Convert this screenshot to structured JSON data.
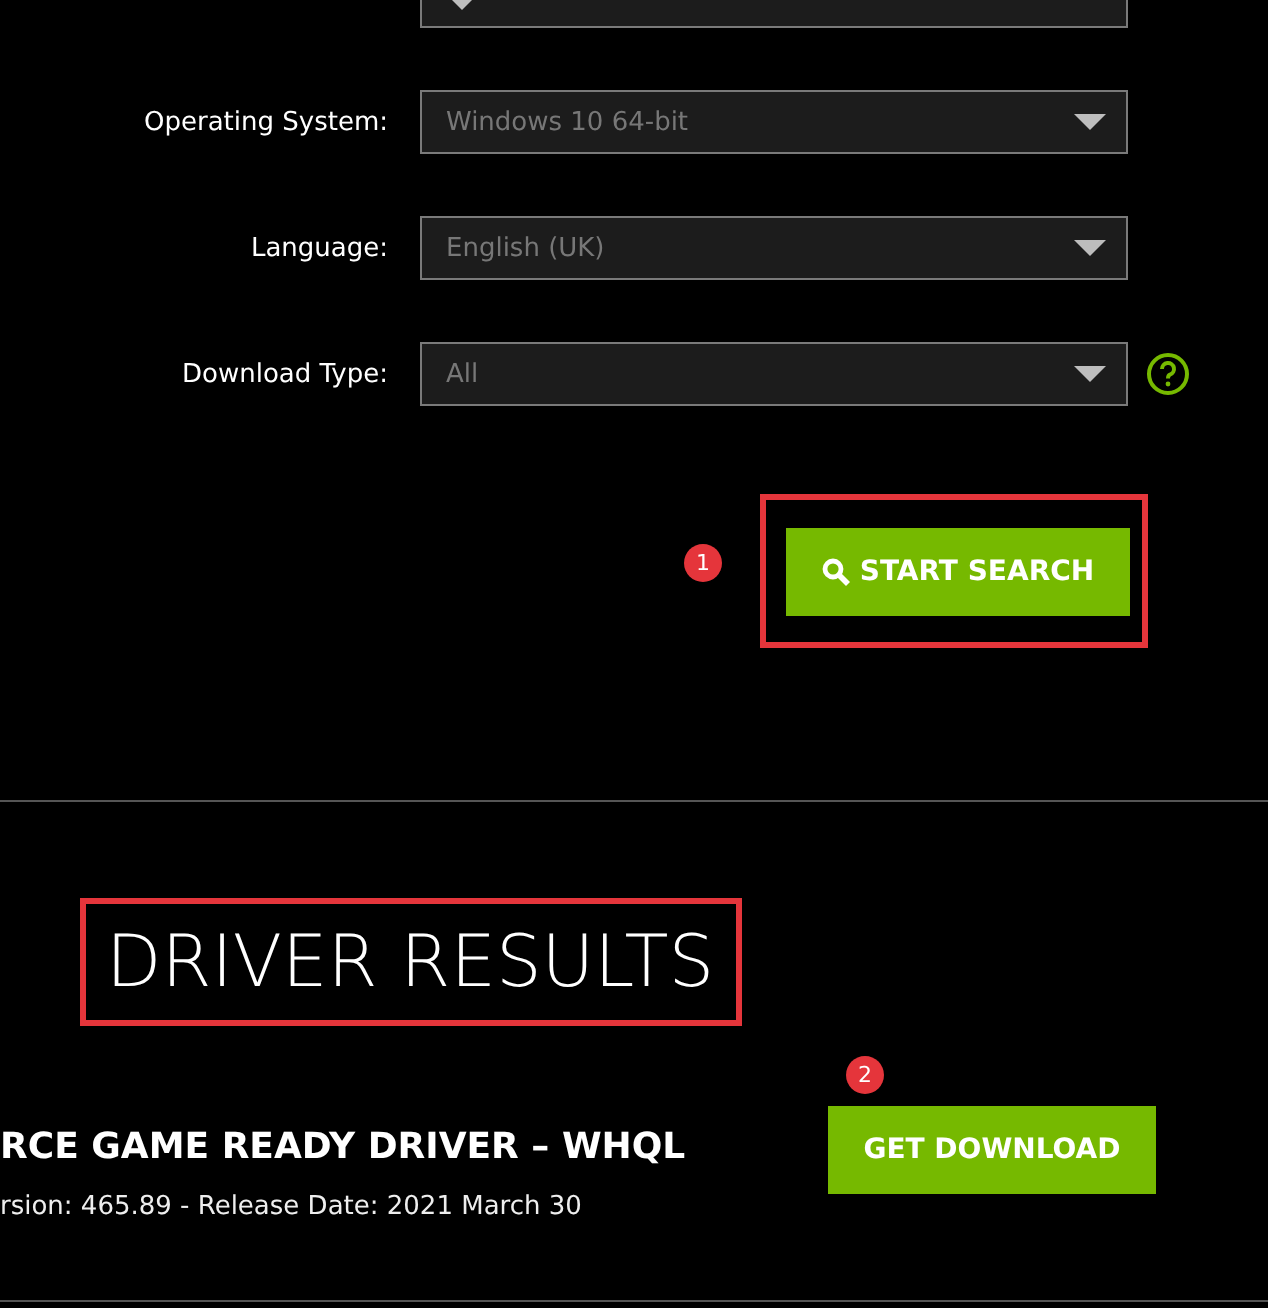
{
  "form": {
    "fields": [
      {
        "label": "Operating System:",
        "value": "Windows 10 64-bit",
        "help": false
      },
      {
        "label": "Language:",
        "value": "English (UK)",
        "help": false
      },
      {
        "label": "Download Type:",
        "value": "All",
        "help": true
      }
    ],
    "search_button": {
      "label": "START SEARCH",
      "highlighted": true,
      "badge": "1"
    }
  },
  "results": {
    "heading": "DRIVER RESULTS",
    "heading_highlighted": true,
    "driver": {
      "title": "RCE GAME READY DRIVER – WHQL",
      "details": "rsion: 465.89 - Release Date: 2021 March 30"
    },
    "download_button": {
      "label": "GET DOWNLOAD",
      "badge": "2"
    }
  }
}
